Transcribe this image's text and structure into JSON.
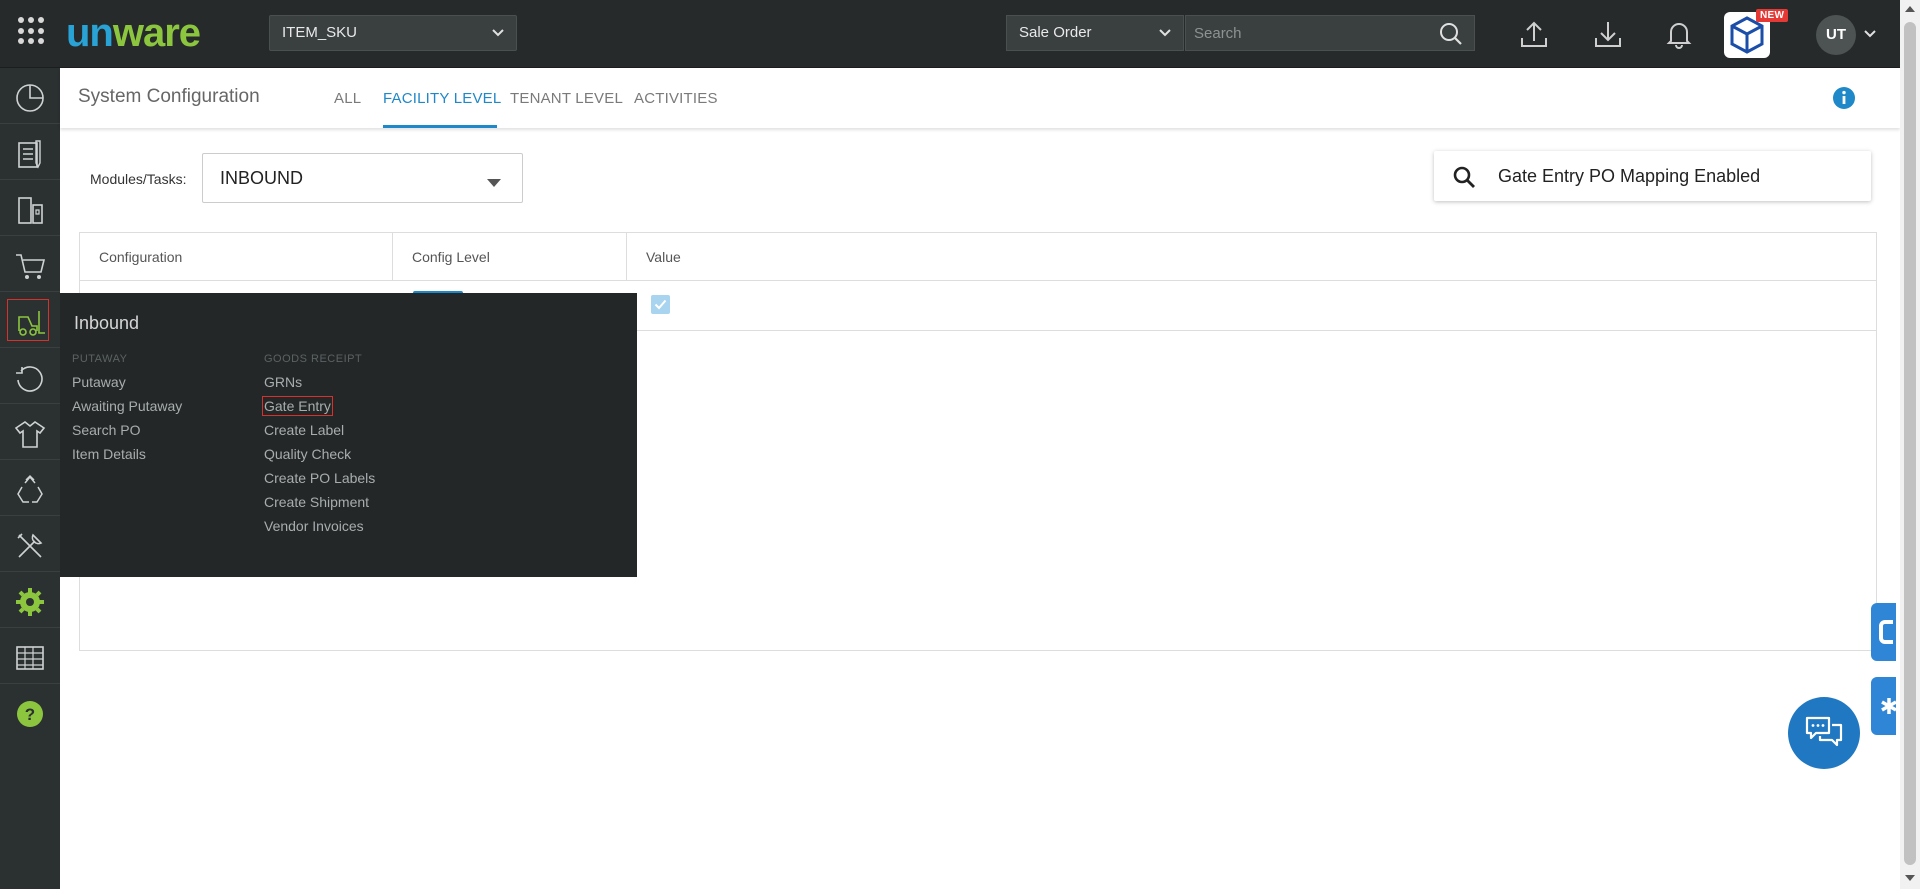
{
  "topbar": {
    "logo_text": "unware",
    "sku_select": "ITEM_SKU",
    "order_type_select": "Sale Order",
    "search_placeholder": "Search",
    "new_badge": "NEW",
    "avatar_initials": "UT"
  },
  "header": {
    "title": "System Configuration",
    "tabs": [
      {
        "label": "ALL",
        "active": false
      },
      {
        "label": "FACILITY LEVEL",
        "active": true
      },
      {
        "label": "TENANT LEVEL",
        "active": false
      },
      {
        "label": "ACTIVITIES",
        "active": false
      }
    ]
  },
  "filters": {
    "modules_label": "Modules/Tasks:",
    "modules_value": "INBOUND",
    "search_value": "Gate Entry PO Mapping Enabled"
  },
  "table": {
    "columns": [
      "Configuration",
      "Config Level",
      "Value"
    ],
    "rows": [
      {
        "value_checked": true
      }
    ]
  },
  "flyout": {
    "title": "Inbound",
    "columns": [
      {
        "heading": "PUTAWAY",
        "links": [
          "Putaway",
          "Awaiting Putaway",
          "Search PO",
          "Item Details"
        ]
      },
      {
        "heading": "GOODS RECEIPT",
        "links": [
          "GRNs",
          "Gate Entry",
          "Create Label",
          "Quality Check",
          "Create PO Labels",
          "Create Shipment",
          "Vendor Invoices"
        ]
      }
    ],
    "highlighted_link": "Gate Entry"
  },
  "sidebar": {
    "items": [
      "dashboard-icon",
      "orders-icon",
      "warehouse-icon",
      "cart-icon",
      "forklift-icon",
      "returns-icon",
      "apparel-icon",
      "recycle-icon",
      "tools-icon",
      "settings-icon",
      "reports-icon",
      "help-icon"
    ],
    "active_item": "forklift-icon"
  },
  "colors": {
    "accent": "#1e88c8",
    "topbar_bg": "#262a2b",
    "sidebar_bg": "#2b3031",
    "logo_blue": "#29a3d6",
    "logo_green": "#8cc63f",
    "highlight_red": "#d6322d"
  }
}
